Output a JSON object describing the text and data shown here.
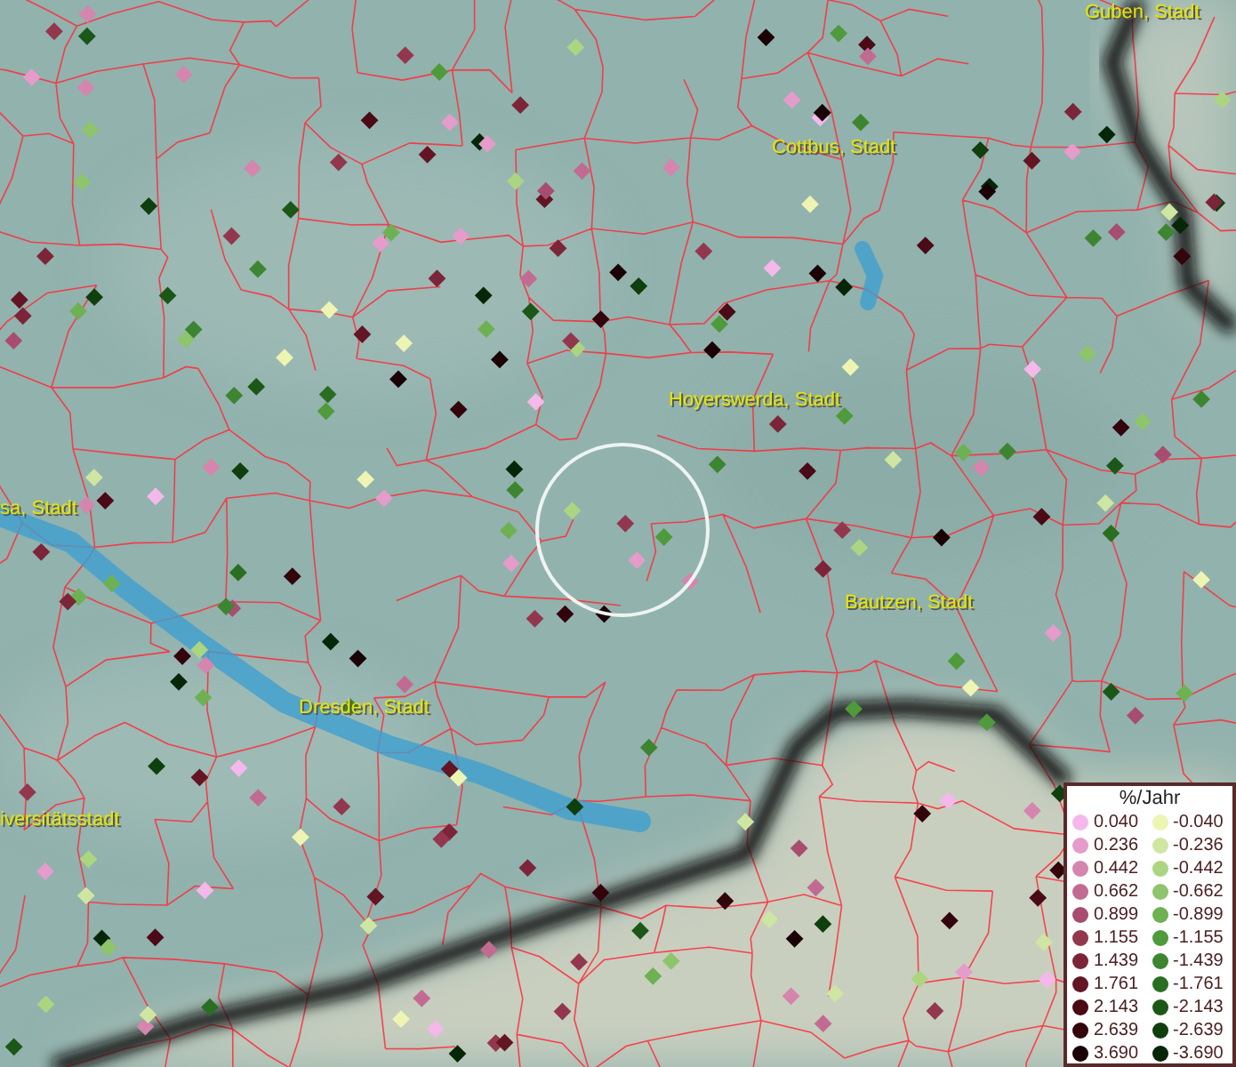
{
  "map": {
    "place_labels": [
      {
        "text": "Guben, Stadt"
      },
      {
        "text": "Cottbus, Stadt"
      },
      {
        "text": "Hoyerswerda, Stadt"
      },
      {
        "text": "sa, Stadt"
      },
      {
        "text": "Bautzen, Stadt"
      },
      {
        "text": "Dresden, Stadt"
      },
      {
        "text": "iversitätsstadt"
      }
    ]
  },
  "legend": {
    "title": "%/Jahr",
    "items": [
      {
        "label": "0.040",
        "color": "#f5b8ea"
      },
      {
        "label": "-0.040",
        "color": "#eef4b2"
      },
      {
        "label": "0.236",
        "color": "#e59ccb"
      },
      {
        "label": "-0.236",
        "color": "#cfe6a2"
      },
      {
        "label": "0.442",
        "color": "#d585ae"
      },
      {
        "label": "-0.442",
        "color": "#acd582"
      },
      {
        "label": "0.662",
        "color": "#c26b92"
      },
      {
        "label": "-0.662",
        "color": "#8ec46b"
      },
      {
        "label": "0.899",
        "color": "#a84d70"
      },
      {
        "label": "-0.899",
        "color": "#6db152"
      },
      {
        "label": "1.155",
        "color": "#93374f"
      },
      {
        "label": "-1.155",
        "color": "#4f9a3b"
      },
      {
        "label": "1.439",
        "color": "#7c2538"
      },
      {
        "label": "-1.439",
        "color": "#3d8531"
      },
      {
        "label": "1.761",
        "color": "#631524"
      },
      {
        "label": "-1.761",
        "color": "#2a6e22"
      },
      {
        "label": "2.143",
        "color": "#4a0a16"
      },
      {
        "label": "-2.143",
        "color": "#1b5717"
      },
      {
        "label": "2.639",
        "color": "#33040c"
      },
      {
        "label": "-2.639",
        "color": "#0e3f0d"
      },
      {
        "label": "3.690",
        "color": "#1a0106"
      },
      {
        "label": "-3.690",
        "color": "#062707"
      }
    ]
  }
}
